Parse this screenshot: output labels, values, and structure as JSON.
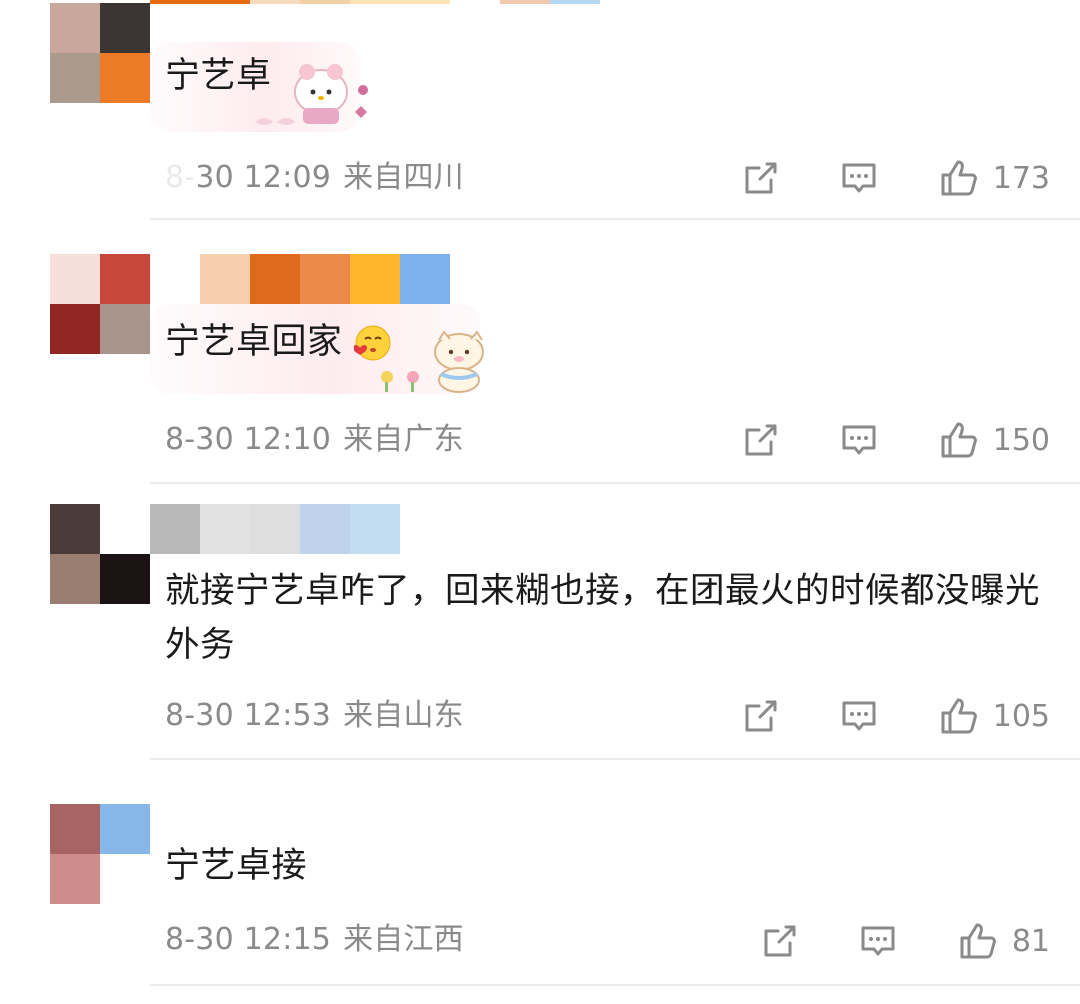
{
  "comments": [
    {
      "text": "宁艺卓",
      "time": "8-30 12:09",
      "location": "来自四川",
      "likes": "173",
      "avatar_colors": [
        "#c9a79c",
        "#3b3533",
        "#ab9b8e",
        "#ec7a27"
      ],
      "sticker": "hello-kitty-sticker"
    },
    {
      "text": "宁艺卓回家",
      "time": "8-30 12:10",
      "location": "来自广东",
      "likes": "150",
      "avatar_colors": [
        "#f6dedb",
        "#c8473b",
        "#8f2622",
        "#a8948b"
      ],
      "name_colors": [
        "#f5cfae",
        "#e06a1c",
        "#eb8a48",
        "#ffb62a",
        "#7db1ee"
      ],
      "emoji": "kissing-face-emoji",
      "sticker": "cat-sticker"
    },
    {
      "text": "就接宁艺卓咋了，回来糊也接，在团最火的时候都没曝光外务",
      "time": "8-30 12:53",
      "location": "来自山东",
      "likes": "105",
      "avatar_colors": [
        "#4b3c3a",
        "#ffffff",
        "#9b7e72",
        "#1c1414"
      ],
      "name_colors": [
        "#b9b9b9",
        "#e1e1e1",
        "#dedede",
        "#bfd3ec",
        "#c4dcf0"
      ]
    },
    {
      "text": "宁艺卓接",
      "time": "8-30 12:15",
      "location": "来自江西",
      "likes": "81",
      "avatar_colors": [
        "#a86462",
        "#87b7e8",
        "#cd8d8b",
        "#ffffff"
      ]
    }
  ],
  "icons": {
    "share": "share-icon",
    "reply": "comment-icon",
    "like": "thumbs-up-icon"
  }
}
